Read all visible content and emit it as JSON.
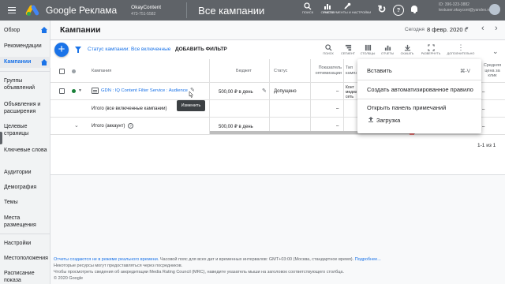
{
  "header": {
    "product_name": "Google Реклама",
    "account_name": "OkayContent",
    "account_id": "473-751-5582",
    "page_title": "Все кампании",
    "tools": [
      {
        "icon": "search-icon",
        "label": "ПОИСК"
      },
      {
        "icon": "chart-icon",
        "label": "ОТЧЕТЫ"
      },
      {
        "icon": "wrench-icon",
        "label": "ИНСТРУМЕНТЫ И НАСТРОЙКИ"
      }
    ],
    "user_line1": "ID: 396-323-3882",
    "user_line2": "testuser.okaycont@yandex.ru"
  },
  "sidebar": {
    "items": [
      {
        "label": "Обзор"
      },
      {
        "label": "Рекомендации"
      },
      {
        "label": "Кампании"
      },
      {
        "label": "Группы объявлений"
      },
      {
        "label": "Объявления и расширения"
      },
      {
        "label": "Целевые страницы"
      },
      {
        "label": "Ключевые слова"
      },
      {
        "label": "Аудитории"
      },
      {
        "label": "Демография"
      },
      {
        "label": "Темы"
      },
      {
        "label": "Места размещения"
      },
      {
        "label": "Настройки"
      },
      {
        "label": "Местоположения"
      },
      {
        "label": "Расписание показа"
      }
    ]
  },
  "main": {
    "title": "Кампании",
    "date_label": "Сегодня",
    "date_value": "8 февр. 2020 г.",
    "filter_prefix": "Статус кампании:",
    "filter_value": "Все включенные",
    "add_filter": "ДОБАВИТЬ ФИЛЬТР",
    "toolbar": [
      {
        "icon": "search-icon",
        "label": "ПОИСК"
      },
      {
        "icon": "segment-icon",
        "label": "СЕГМЕНТ"
      },
      {
        "icon": "columns-icon",
        "label": "СТОЛБЦЫ"
      },
      {
        "icon": "chart-icon",
        "label": "ОТЧЕТЫ"
      },
      {
        "icon": "download-icon",
        "label": "СКАЧАТЬ"
      },
      {
        "icon": "expand-icon",
        "label": "РАЗВЕРНУТЬ"
      },
      {
        "icon": "more-icon",
        "label": "ДОПОЛНИТЕЛЬНО"
      }
    ]
  },
  "table": {
    "headers": {
      "campaign": "Кампания",
      "budget": "Бюджет",
      "status": "Статус",
      "opt": "Показатель оптимизации",
      "type": "Тип кампании",
      "right": "Средняя цена за клик"
    },
    "rows": [
      {
        "name": "GDN : IQ Content Filter Service : Audience",
        "budget": "500,00 ₽ в день",
        "status": "Допущено",
        "opt": "–",
        "type": "Конт медиа сеть"
      },
      {
        "name": "Итого (все включенные кампании)",
        "budget": "",
        "status": "",
        "opt": "–",
        "type": ""
      },
      {
        "name": "Итого (аккаунт)",
        "budget": "500,00 ₽ в день",
        "status": "",
        "opt": "–",
        "type": ""
      }
    ],
    "tooltip": "Изменить",
    "pager": "1-1 из 1",
    "right_values": [
      "–",
      "–",
      "–"
    ]
  },
  "menu": {
    "items": [
      {
        "label": "Вставить",
        "shortcut": "⌘-V"
      },
      {
        "label": "Создать автоматизированное правило"
      },
      {
        "label": "Открыть панель примечаний"
      },
      {
        "label": "Загрузка"
      }
    ]
  },
  "footer": {
    "line1_link": "Отчеты создаются не в режиме реального времени.",
    "line1_text": " Часовой пояс для всех дат и временных интервалов: GMT+03:00 (Москва, стандартное время). ",
    "line1_more": "Подробнее...",
    "line2": "Некоторые ресурсы могут предоставляться через посредников.",
    "line3": "Чтобы просмотреть сведения об аккредитации Media Rating Council (MRC), наведите указатель мыши на заголовок соответствующего столбца.",
    "line4": "© 2020 Google"
  },
  "colors": {
    "header_bg": "#5f6368",
    "accent": "#1a73e8",
    "status_green": "#188038"
  }
}
